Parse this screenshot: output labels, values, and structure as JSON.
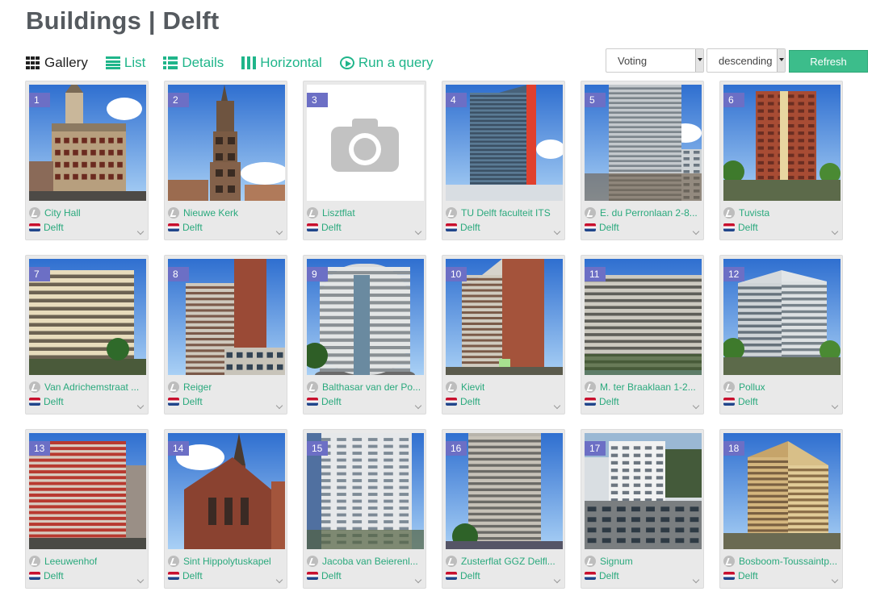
{
  "page": {
    "title": "Buildings | Delft"
  },
  "views": [
    {
      "label": "Gallery",
      "icon": "gallery-grid-icon",
      "active": true
    },
    {
      "label": "List",
      "icon": "list-icon",
      "active": false
    },
    {
      "label": "Details",
      "icon": "details-icon",
      "active": false
    },
    {
      "label": "Horizontal",
      "icon": "horizontal-columns-icon",
      "active": false
    },
    {
      "label": "Run a query",
      "icon": "play-circle-icon",
      "active": false
    }
  ],
  "sort": {
    "field": "Voting",
    "order": "descending",
    "refresh_label": "Refresh"
  },
  "colors": {
    "accent": "#1fb58a",
    "refresh": "#3cbd8b",
    "badge": "#6c6fc5",
    "card_bg": "#e9e9e9"
  },
  "buildings": [
    {
      "num": "1",
      "name": "City Hall",
      "city": "Delft",
      "photo": "classic-ornate-building"
    },
    {
      "num": "2",
      "name": "Nieuwe Kerk",
      "city": "Delft",
      "photo": "church-tower"
    },
    {
      "num": "3",
      "name": "Lisztflat",
      "city": "Delft",
      "photo": "placeholder-camera"
    },
    {
      "num": "4",
      "name": "TU Delft faculteit ITS",
      "city": "Delft",
      "photo": "glass-highrise-red-edge"
    },
    {
      "num": "5",
      "name": "E. du Perronlaan 2-8...",
      "city": "Delft",
      "photo": "white-apartment-block"
    },
    {
      "num": "6",
      "name": "Tuvista",
      "city": "Delft",
      "photo": "brick-tower-trees"
    },
    {
      "num": "7",
      "name": "Van Adrichemstraat ...",
      "city": "Delft",
      "photo": "balcony-apartment"
    },
    {
      "num": "8",
      "name": "Reiger",
      "city": "Delft",
      "photo": "brick-highrise"
    },
    {
      "num": "9",
      "name": "Balthasar van der Po...",
      "city": "Delft",
      "photo": "round-modern-tower"
    },
    {
      "num": "10",
      "name": "Kievit",
      "city": "Delft",
      "photo": "brick-highrise-side"
    },
    {
      "num": "11",
      "name": "M. ter Braaklaan 1-2...",
      "city": "Delft",
      "photo": "long-slab-building"
    },
    {
      "num": "12",
      "name": "Pollux",
      "city": "Delft",
      "photo": "white-tower-trees"
    },
    {
      "num": "13",
      "name": "Leeuwenhof",
      "city": "Delft",
      "photo": "red-stripe-tower"
    },
    {
      "num": "14",
      "name": "Sint Hippolytuskapel",
      "city": "Delft",
      "photo": "brick-chapel"
    },
    {
      "num": "15",
      "name": "Jacoba van Beierenl...",
      "city": "Delft",
      "photo": "white-slab-tower"
    },
    {
      "num": "16",
      "name": "Zusterflat GGZ Delfl...",
      "city": "Delft",
      "photo": "grey-tower"
    },
    {
      "num": "17",
      "name": "Signum",
      "city": "Delft",
      "photo": "modern-white-complex"
    },
    {
      "num": "18",
      "name": "Bosboom-Toussaintp...",
      "city": "Delft",
      "photo": "tan-stepped-tower"
    }
  ]
}
